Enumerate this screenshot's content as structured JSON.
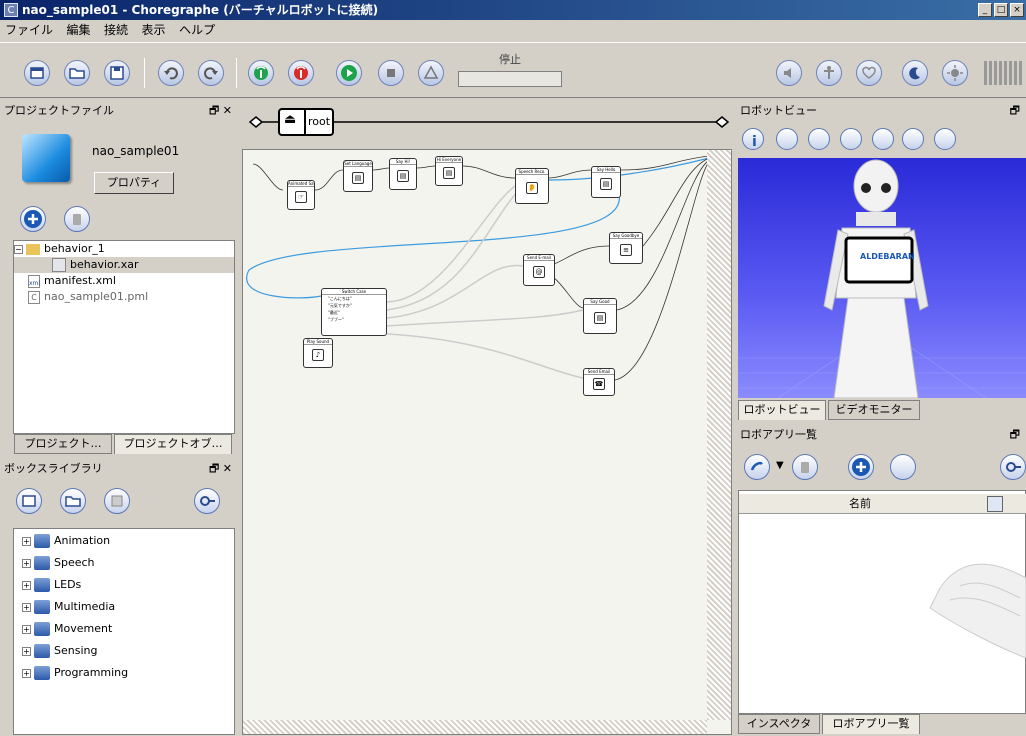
{
  "window": {
    "title": "nao_sample01 - Choregraphe (バーチャルロボットに接続)",
    "app_icon": "C",
    "btn_min": "_",
    "btn_max": "□",
    "btn_close": "×"
  },
  "menu": [
    "ファイル",
    "編集",
    "接続",
    "表示",
    "ヘルプ"
  ],
  "toolbar": {
    "status_label": "停止"
  },
  "project_panel": {
    "title": "プロジェクトファイル",
    "project_name": "nao_sample01",
    "properties_button": "プロパティ",
    "tree": [
      {
        "label": "behavior_1",
        "type": "folder",
        "expanded": true,
        "depth": 0
      },
      {
        "label": "behavior.xar",
        "type": "file",
        "depth": 1,
        "selected": true
      },
      {
        "label": "manifest.xml",
        "type": "xml",
        "depth": 0
      },
      {
        "label": "nao_sample01.pml",
        "type": "pml",
        "depth": 0
      }
    ],
    "tabs": [
      "プロジェクト…",
      "プロジェクトオブ…"
    ]
  },
  "library_panel": {
    "title": "ボックスライブラリ",
    "items": [
      "Animation",
      "Speech",
      "LEDs",
      "Multimedia",
      "Movement",
      "Sensing",
      "Programming"
    ]
  },
  "flow": {
    "breadcrumb": "root",
    "boxes": [
      {
        "id": "b1",
        "title": "Animated Say",
        "icon": "☞"
      },
      {
        "id": "b2",
        "title": "Set Language",
        "icon": "▤"
      },
      {
        "id": "b3",
        "title": "Say Hi!",
        "icon": "▤"
      },
      {
        "id": "b4",
        "title": "Hi Everyone",
        "icon": "▤"
      },
      {
        "id": "b5",
        "title": "Speech Reco.",
        "icon": "👂"
      },
      {
        "id": "b6",
        "title": "Say Hello",
        "icon": "▤"
      },
      {
        "id": "b7",
        "title": "Say Goodbye",
        "icon": "≡"
      },
      {
        "id": "b8",
        "title": "Send E-mail",
        "icon": "@"
      },
      {
        "id": "b9",
        "title": "Switch Case",
        "icon": ""
      },
      {
        "id": "b10",
        "title": "Say Good",
        "icon": "▤"
      },
      {
        "id": "b11",
        "title": "Play Sound",
        "icon": "♪"
      },
      {
        "id": "b12",
        "title": "Send Email",
        "icon": "☎"
      }
    ],
    "switch_cases": [
      "\"こんにちは\"",
      "\"元気ですか\"",
      "\"最近\"",
      "\"ブブー\""
    ]
  },
  "robot_view": {
    "title": "ロボットビュー",
    "tabs": [
      "ロボットビュー",
      "ビデオモニター"
    ],
    "screen_text": "ALDEBARAN"
  },
  "app_list": {
    "title": "ロボアプリ一覧",
    "column": "名前",
    "tabs": [
      "インスペクタ",
      "ロボアプリ一覧"
    ]
  },
  "colors": {
    "titlebar": "#0a246a",
    "accent": "#3a6ea5",
    "wire_blue": "#3b9be0"
  }
}
